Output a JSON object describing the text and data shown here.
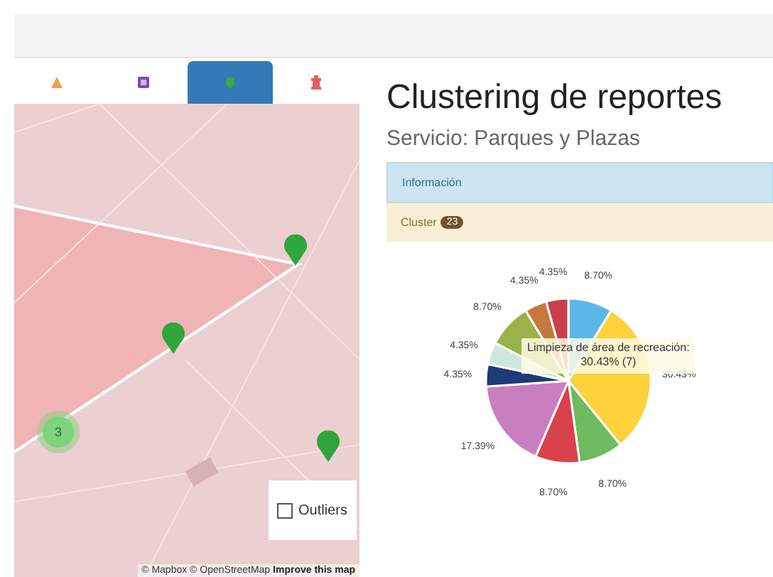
{
  "tabs": [
    {
      "kind": "cone",
      "selected": false
    },
    {
      "kind": "box",
      "selected": false
    },
    {
      "kind": "dot",
      "selected": true
    },
    {
      "kind": "hydrant",
      "selected": false
    }
  ],
  "map": {
    "cluster_count": "3",
    "outliers": {
      "label": "Outliers",
      "checked": false
    },
    "attribution": "© Mapbox © OpenStreetMap",
    "improve_link": "Improve this map"
  },
  "title": "Clustering de reportes",
  "subtitle": "Servicio: Parques y Plazas",
  "info_bar": "Información",
  "cluster_bar": {
    "label": "Cluster",
    "count": "23"
  },
  "chart_data": {
    "type": "pie",
    "values": [
      8.7,
      30.43,
      8.7,
      8.7,
      17.39,
      4.35,
      4.35,
      8.7,
      4.35,
      4.35
    ],
    "colors": [
      "#5bb8e6",
      "#fdd23a",
      "#6dbb5f",
      "#d9424a",
      "#c97fbf",
      "#1f3a78",
      "#cfe6de",
      "#9bb24a",
      "#c7783c",
      "#c8414a"
    ],
    "value_labels": [
      "8.70%",
      "30.43%",
      "8.70%",
      "8.70%",
      "17.39%",
      "4.35%",
      "4.35%",
      "8.70%",
      "4.35%",
      "4.35%"
    ],
    "annotations": [
      {
        "text": "Limpieza de área de recreación:"
      },
      {
        "text": "30.43% (7)"
      }
    ]
  }
}
